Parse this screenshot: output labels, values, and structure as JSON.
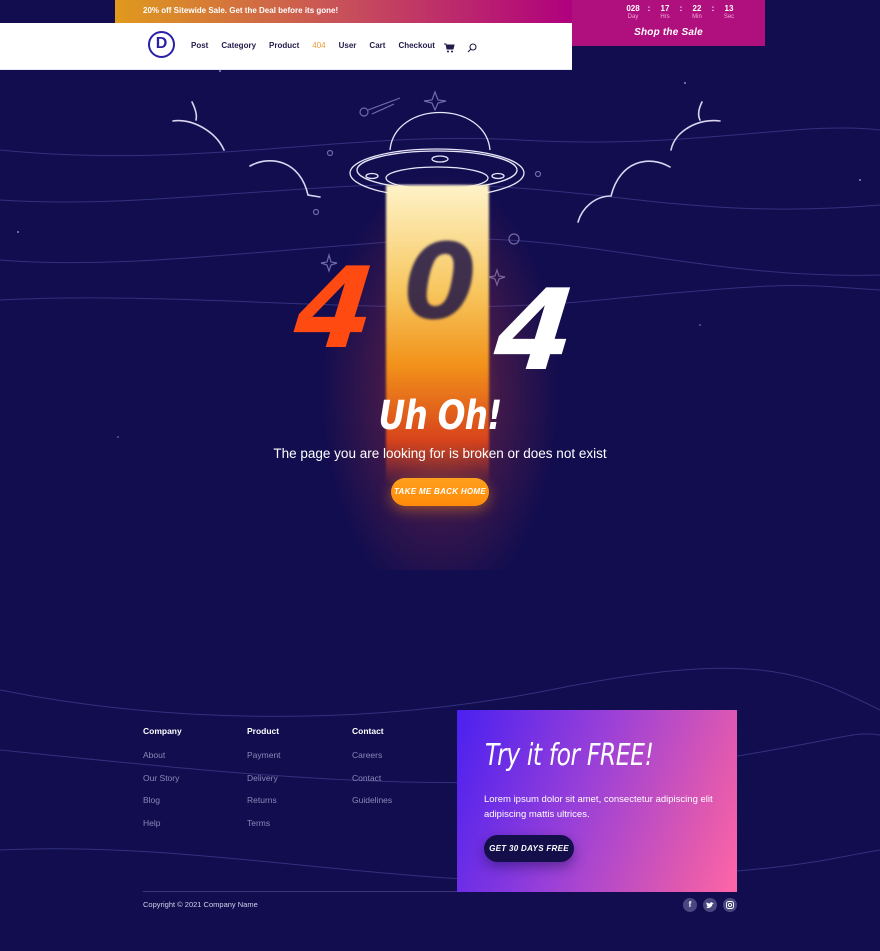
{
  "topbar": {
    "promo": "20% off Sitewide Sale. Get the Deal before its gone!",
    "countdown": [
      {
        "value": "028",
        "label": "Day"
      },
      {
        "value": "17",
        "label": "Hrs"
      },
      {
        "value": "22",
        "label": "Min"
      },
      {
        "value": "13",
        "label": "Sec"
      }
    ],
    "separator": ":",
    "shop_label": "Shop the Sale"
  },
  "nav": {
    "logo": "D",
    "items": [
      {
        "label": "Post"
      },
      {
        "label": "Category"
      },
      {
        "label": "Product"
      },
      {
        "label": "404",
        "active": true
      },
      {
        "label": "User"
      },
      {
        "label": "Cart"
      },
      {
        "label": "Checkout"
      }
    ],
    "icons": [
      "cart-icon",
      "search-icon"
    ]
  },
  "hero": {
    "digits": [
      "4",
      "0",
      "4"
    ],
    "heading": "Uh Oh!",
    "subtitle": "The page you are looking for is broken or does not exist",
    "button": "TAKE ME BACK HOME"
  },
  "footer": {
    "columns": [
      {
        "title": "Company",
        "links": [
          "About",
          "Our Story",
          "Blog",
          "Help"
        ]
      },
      {
        "title": "Product",
        "links": [
          "Payment",
          "Delivery",
          "Returns",
          "Terms"
        ]
      },
      {
        "title": "Contact",
        "links": [
          "Careers",
          "Contact",
          "Guidelines"
        ]
      }
    ],
    "promo": {
      "title": "Try it for FREE!",
      "text": "Lorem ipsum dolor sit amet, consectetur adipiscing elit adipiscing mattis ultrices.",
      "button": "GET 30 DAYS FREE"
    },
    "copyright": "Copyright © 2021 Company Name",
    "social": [
      {
        "name": "facebook",
        "glyph": "f"
      },
      {
        "name": "twitter",
        "glyph": "t"
      },
      {
        "name": "instagram",
        "glyph": "◎"
      }
    ]
  },
  "colors": {
    "background": "#120d4f",
    "accent_orange": "#ff8c0a",
    "digit_red": "#ff4a12",
    "sale_magenta": "#b0107e"
  }
}
